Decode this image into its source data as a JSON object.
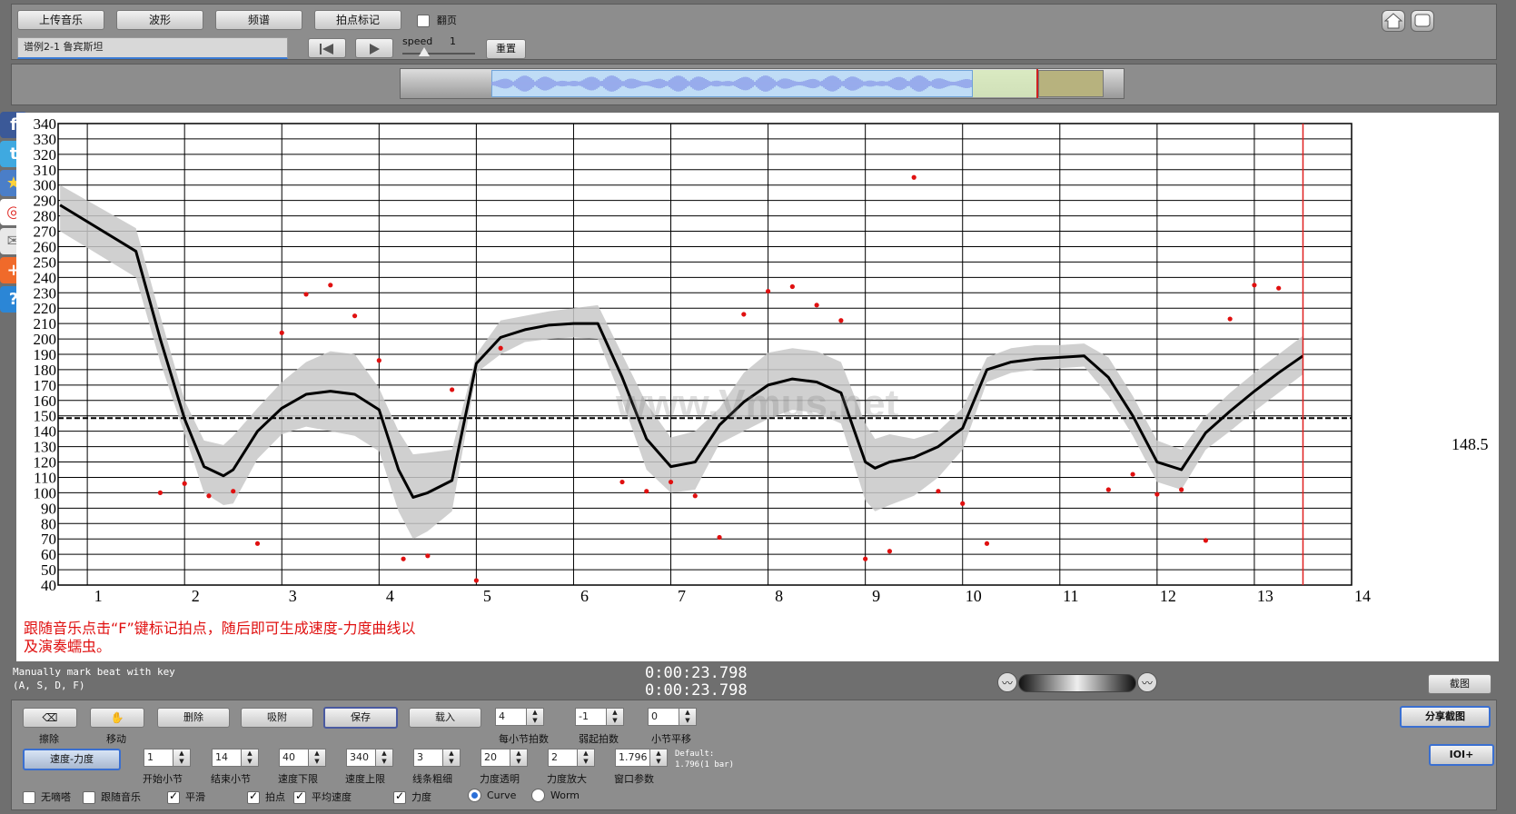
{
  "toolbar": {
    "upload": "上传音乐",
    "waveform": "波形",
    "spectrum": "频谱",
    "beat_mark": "拍点标记",
    "page_turn": "翻页",
    "title_value": "谱例2-1 鲁宾斯坦",
    "speed_label": "speed",
    "speed_value": "1",
    "speed_level": 0.3,
    "reset": "重置"
  },
  "overlay_text": {
    "instruction_line1": "跟随音乐点击“F”键标记拍点，随后即可生成速度-力度曲线以",
    "instruction_line2": "及演奏蠕虫。",
    "watermark": "www.Vmus.net",
    "reference_value": "148.5"
  },
  "status": {
    "hint_line1": "Manually mark beat with key",
    "hint_line2": "(A, S, D, F)",
    "time1": "0:00:23.798",
    "time2": "0:00:23.798",
    "screenshot": "截图",
    "share_screenshot": "分享截图",
    "ioi": "IOI+"
  },
  "controls": {
    "erase": "擦除",
    "move": "移动",
    "delete": "删除",
    "snap": "吸附",
    "save": "保存",
    "load": "载入",
    "tempo_dynamics": "速度-力度",
    "beats_per_bar": {
      "value": "4",
      "label": "每小节拍数"
    },
    "pickup": {
      "value": "-1",
      "label": "弱起拍数"
    },
    "bar_shift": {
      "value": "0",
      "label": "小节平移"
    },
    "start_bar": {
      "value": "1",
      "label": "开始小节"
    },
    "end_bar": {
      "value": "14",
      "label": "结束小节"
    },
    "tempo_min": {
      "value": "40",
      "label": "速度下限"
    },
    "tempo_max": {
      "value": "340",
      "label": "速度上限"
    },
    "line_width": {
      "value": "3",
      "label": "线条粗细"
    },
    "dyn_alpha": {
      "value": "20",
      "label": "力度透明"
    },
    "dyn_scale": {
      "value": "2",
      "label": "力度放大"
    },
    "window": {
      "value": "1.796",
      "label": "窗口参数"
    },
    "default_line1": "Default:",
    "default_line2": "1.796(1 bar)",
    "metronome": "无嘀嗒",
    "follow_music": "跟随音乐",
    "smooth": "平滑",
    "beats": "拍点",
    "avg_tempo": "平均速度",
    "dynamics": "力度",
    "curve": "Curve",
    "worm": "Worm"
  },
  "colors": {
    "background": "#6f6f6f",
    "panel": "#8a8a8a",
    "chart_bg": "#ffffff",
    "tempo_line": "#000000",
    "beat_points": "#e01010",
    "dynamics_band": "#c8c8c8",
    "cursor": "#e02020",
    "waveform": "#8a9be8",
    "instruction_text": "#e01010"
  },
  "icons": [
    "home-icon",
    "fullscreen-icon",
    "facebook-icon",
    "twitter-icon",
    "star-icon",
    "weibo-icon",
    "mail-icon",
    "plus-icon",
    "help-icon",
    "wave-left-icon",
    "wave-right-icon",
    "eraser-icon",
    "move-hand-icon"
  ],
  "chart_data": {
    "type": "line",
    "title": "",
    "xlabel": "",
    "ylabel": "",
    "xlim": [
      0.7,
      14
    ],
    "ylim": [
      40,
      340
    ],
    "x_ticks": [
      1,
      2,
      3,
      4,
      5,
      6,
      7,
      8,
      9,
      10,
      11,
      12,
      13,
      14
    ],
    "y_ticks": [
      40,
      50,
      60,
      70,
      80,
      90,
      100,
      110,
      120,
      130,
      140,
      150,
      160,
      170,
      180,
      190,
      200,
      210,
      220,
      230,
      240,
      250,
      260,
      270,
      280,
      290,
      300,
      310,
      320,
      330,
      340
    ],
    "grid": true,
    "reference_line": 148.5,
    "cursor_x": 13.5,
    "series": [
      {
        "kind": "tempo_curve",
        "x": [
          0.72,
          1.5,
          1.75,
          2.0,
          2.2,
          2.4,
          2.5,
          2.75,
          3.0,
          3.25,
          3.5,
          3.75,
          4.0,
          4.2,
          4.35,
          4.5,
          4.75,
          5.0,
          5.25,
          5.5,
          5.75,
          6.0,
          6.25,
          6.5,
          6.75,
          7.0,
          7.25,
          7.5,
          7.75,
          8.0,
          8.25,
          8.5,
          8.75,
          9.0,
          9.1,
          9.25,
          9.5,
          9.75,
          10.0,
          10.25,
          10.5,
          10.75,
          11.0,
          11.25,
          11.5,
          11.75,
          12.0,
          12.25,
          12.5,
          12.75,
          13.0,
          13.25,
          13.5
        ],
        "y": [
          287,
          257,
          200,
          148,
          117,
          111,
          115,
          140,
          155,
          164,
          166,
          164,
          154,
          115,
          97,
          100,
          108,
          184,
          201,
          206,
          209,
          210,
          210,
          175,
          135,
          117,
          120,
          144,
          159,
          170,
          174,
          172,
          165,
          120,
          116,
          120,
          123,
          130,
          142,
          180,
          185,
          187,
          188,
          189,
          175,
          150,
          120,
          115,
          139,
          153,
          166,
          178,
          189
        ]
      },
      {
        "kind": "dynamics_upper",
        "x": [
          0.72,
          1.5,
          1.75,
          2.0,
          2.2,
          2.4,
          2.5,
          2.75,
          3.0,
          3.25,
          3.5,
          3.75,
          4.0,
          4.2,
          4.35,
          4.5,
          4.75,
          5.0,
          5.25,
          5.5,
          5.75,
          6.0,
          6.25,
          6.5,
          6.75,
          7.0,
          7.25,
          7.5,
          7.75,
          8.0,
          8.25,
          8.5,
          8.75,
          9.0,
          9.1,
          9.25,
          9.5,
          9.75,
          10.0,
          10.25,
          10.5,
          10.75,
          11.0,
          11.25,
          11.5,
          11.75,
          12.0,
          12.25,
          12.5,
          12.75,
          13.0,
          13.25,
          13.5
        ],
        "y": [
          300,
          272,
          215,
          160,
          134,
          131,
          137,
          155,
          172,
          185,
          192,
          190,
          168,
          140,
          125,
          126,
          128,
          190,
          212,
          215,
          218,
          220,
          222,
          190,
          158,
          136,
          140,
          155,
          178,
          191,
          194,
          192,
          185,
          145,
          135,
          138,
          135,
          140,
          155,
          188,
          194,
          196,
          196,
          197,
          188,
          163,
          134,
          128,
          150,
          165,
          178,
          190,
          202
        ]
      },
      {
        "kind": "dynamics_lower",
        "x": [
          0.72,
          1.5,
          1.75,
          2.0,
          2.2,
          2.4,
          2.5,
          2.75,
          3.0,
          3.25,
          3.5,
          3.75,
          4.0,
          4.2,
          4.35,
          4.5,
          4.75,
          5.0,
          5.25,
          5.5,
          5.75,
          6.0,
          6.25,
          6.5,
          6.75,
          7.0,
          7.25,
          7.5,
          7.75,
          8.0,
          8.25,
          8.5,
          8.75,
          9.0,
          9.1,
          9.25,
          9.5,
          9.75,
          10.0,
          10.25,
          10.5,
          10.75,
          11.0,
          11.25,
          11.5,
          11.75,
          12.0,
          12.25,
          12.5,
          12.75,
          13.0,
          13.25,
          13.5
        ],
        "y": [
          270,
          240,
          185,
          138,
          100,
          92,
          93,
          122,
          138,
          143,
          140,
          137,
          127,
          88,
          70,
          75,
          88,
          178,
          190,
          198,
          200,
          201,
          200,
          160,
          115,
          100,
          102,
          132,
          140,
          148,
          154,
          152,
          145,
          95,
          88,
          92,
          98,
          110,
          128,
          172,
          178,
          180,
          181,
          182,
          163,
          137,
          107,
          102,
          128,
          140,
          153,
          165,
          177
        ]
      },
      {
        "kind": "beat_points",
        "x": [
          1.75,
          2.0,
          2.25,
          2.5,
          2.75,
          3.0,
          3.25,
          3.5,
          3.75,
          4.0,
          4.25,
          4.5,
          4.75,
          5.0,
          5.25,
          6.5,
          6.75,
          7.0,
          7.25,
          7.5,
          7.75,
          8.0,
          8.25,
          8.5,
          8.75,
          9.0,
          9.25,
          9.5,
          9.75,
          10.0,
          10.25,
          11.5,
          11.75,
          12.0,
          12.25,
          12.5,
          12.75,
          13.0,
          13.25
        ],
        "y": [
          100,
          106,
          98,
          101,
          67,
          204,
          229,
          235,
          215,
          186,
          57,
          59,
          167,
          43,
          194,
          107,
          101,
          107,
          98,
          71,
          216,
          231,
          234,
          222,
          212,
          57,
          62,
          305,
          101,
          93,
          67,
          102,
          112,
          99,
          102,
          69,
          213,
          235,
          233
        ]
      }
    ]
  }
}
